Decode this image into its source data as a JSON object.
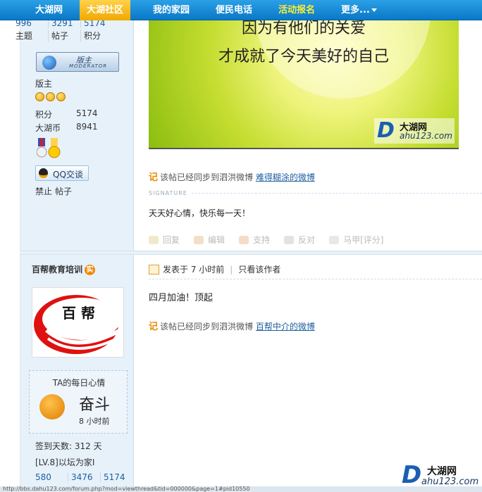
{
  "nav": {
    "partial_left": "",
    "items": [
      "大湖网",
      "大湖社区",
      "我的家园",
      "便民电话",
      "活动报名",
      "更多..."
    ],
    "active_index": 1
  },
  "user1": {
    "stats_values": [
      "996",
      "3291",
      "5174"
    ],
    "stats_labels": [
      "主题",
      "帖子",
      "积分"
    ],
    "badge_main": "版主",
    "badge_sub": "MODERATOR",
    "group": "版主",
    "points_label": "积分",
    "points_value": "5174",
    "coins_label": "大湖币",
    "coins_value": "8941",
    "qq_label": "QQ交谈",
    "ban_label": "禁止",
    "posts_link": "帖子"
  },
  "post1": {
    "banner_line1": "因为有他们的关爱",
    "banner_line2": "才成就了今天美好的自己",
    "logo_main": "大湖网",
    "logo_url": "ahu123.com",
    "logo_letter": "D",
    "sync_prefix": "该帖已经同步到泗洪微博",
    "sync_link": "难得糊涂的微博",
    "signature_label": "SIGNATURE",
    "signature_text": "天天好心情，快乐每一天！",
    "actions": [
      "回复",
      "编辑",
      "支持",
      "反对",
      "马甲[评分]"
    ]
  },
  "user2": {
    "name": "百帮教育培训",
    "badge": "实",
    "avatar_text": "百 帮",
    "mood_title": "TA的每日心情",
    "mood_word": "奋斗",
    "mood_time": "8 小时前",
    "checkin": "签到天数: 312 天",
    "level": "[LV.8]以坛为家I",
    "stats_values": [
      "580",
      "3476",
      "5174"
    ]
  },
  "post2": {
    "posted": "发表于 7 小时前",
    "only_author": "只看该作者",
    "body": "四月加油！顶起",
    "sync_prefix": "该帖已经同步到泗洪微博",
    "sync_link": "百帮中介的微博"
  },
  "footer": {
    "logo_main": "大湖网",
    "logo_url": "ahu123.com",
    "logo_letter": "D",
    "status_text": "http://bbs.dahu123.com/forum.php?mod=viewthread&tid=000000&page=1#pid10550"
  }
}
